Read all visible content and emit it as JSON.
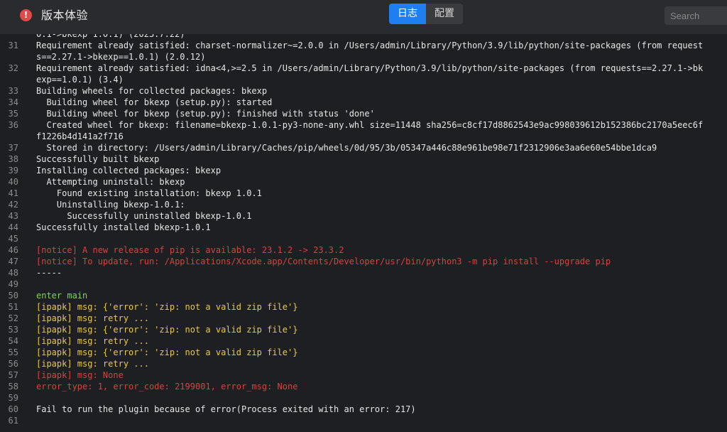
{
  "header": {
    "title": "版本体验",
    "alert_icon": "exclamation-circle-icon",
    "tabs": [
      {
        "label": "日志",
        "active": true
      },
      {
        "label": "配置",
        "active": false
      }
    ],
    "search_placeholder": "Search"
  },
  "colors": {
    "accent": "#1f7ff0",
    "error": "#d9413e",
    "success": "#7fd44f",
    "warning": "#e8c94a"
  },
  "log_lines": [
    {
      "n": "",
      "text": "0.1->bkexp 1.0.1) (2023.7.22)",
      "color": "default"
    },
    {
      "n": "31",
      "text": "Requirement already satisfied: charset-normalizer~=2.0.0 in /Users/admin/Library/Python/3.9/lib/python/site-packages (from requests==2.27.1->bkexp==1.0.1) (2.0.12)",
      "color": "default"
    },
    {
      "n": "32",
      "text": "Requirement already satisfied: idna<4,>=2.5 in /Users/admin/Library/Python/3.9/lib/python/site-packages (from requests==2.27.1->bkexp==1.0.1) (3.4)",
      "color": "default"
    },
    {
      "n": "33",
      "text": "Building wheels for collected packages: bkexp",
      "color": "default"
    },
    {
      "n": "34",
      "text": "  Building wheel for bkexp (setup.py): started",
      "color": "default"
    },
    {
      "n": "35",
      "text": "  Building wheel for bkexp (setup.py): finished with status 'done'",
      "color": "default"
    },
    {
      "n": "36",
      "text": "  Created wheel for bkexp: filename=bkexp-1.0.1-py3-none-any.whl size=11448 sha256=c8cf17d8862543e9ac998039612b152386bc2170a5eec6ff1226b4d141a2f716",
      "color": "default"
    },
    {
      "n": "37",
      "text": "  Stored in directory: /Users/admin/Library/Caches/pip/wheels/0d/95/3b/05347a446c88e961be98e71f2312906e3aa6e60e54bbe1dca9",
      "color": "default"
    },
    {
      "n": "38",
      "text": "Successfully built bkexp",
      "color": "default"
    },
    {
      "n": "39",
      "text": "Installing collected packages: bkexp",
      "color": "default"
    },
    {
      "n": "40",
      "text": "  Attempting uninstall: bkexp",
      "color": "default"
    },
    {
      "n": "41",
      "text": "    Found existing installation: bkexp 1.0.1",
      "color": "default"
    },
    {
      "n": "42",
      "text": "    Uninstalling bkexp-1.0.1:",
      "color": "default"
    },
    {
      "n": "43",
      "text": "      Successfully uninstalled bkexp-1.0.1",
      "color": "default"
    },
    {
      "n": "44",
      "text": "Successfully installed bkexp-1.0.1",
      "color": "default"
    },
    {
      "n": "45",
      "text": "",
      "color": "default"
    },
    {
      "n": "46",
      "text": "[notice] A new release of pip is available: 23.1.2 -> 23.3.2",
      "color": "red"
    },
    {
      "n": "47",
      "text": "[notice] To update, run: /Applications/Xcode.app/Contents/Developer/usr/bin/python3 -m pip install --upgrade pip",
      "color": "red"
    },
    {
      "n": "48",
      "text": "-----",
      "color": "default"
    },
    {
      "n": "49",
      "text": "",
      "color": "default"
    },
    {
      "n": "50",
      "text": "enter main",
      "color": "green"
    },
    {
      "n": "51",
      "text": "[ipapk] msg: {'error': 'zip: not a valid zip file'}",
      "color": "yellow"
    },
    {
      "n": "52",
      "text": "[ipapk] msg: retry ...",
      "color": "yellow"
    },
    {
      "n": "53",
      "text": "[ipapk] msg: {'error': 'zip: not a valid zip file'}",
      "color": "yellow"
    },
    {
      "n": "54",
      "text": "[ipapk] msg: retry ...",
      "color": "yellow"
    },
    {
      "n": "55",
      "text": "[ipapk] msg: {'error': 'zip: not a valid zip file'}",
      "color": "yellow"
    },
    {
      "n": "56",
      "text": "[ipapk] msg: retry ...",
      "color": "yellow"
    },
    {
      "n": "57",
      "text": "[ipapk] msg: None",
      "color": "red"
    },
    {
      "n": "58",
      "text": "error_type: 1, error_code: 2199001, error_msg: None",
      "color": "red"
    },
    {
      "n": "59",
      "text": "",
      "color": "default"
    },
    {
      "n": "60",
      "text": "Fail to run the plugin because of error(Process exited with an error: 217)",
      "color": "default"
    },
    {
      "n": "61",
      "text": "",
      "color": "default"
    }
  ]
}
